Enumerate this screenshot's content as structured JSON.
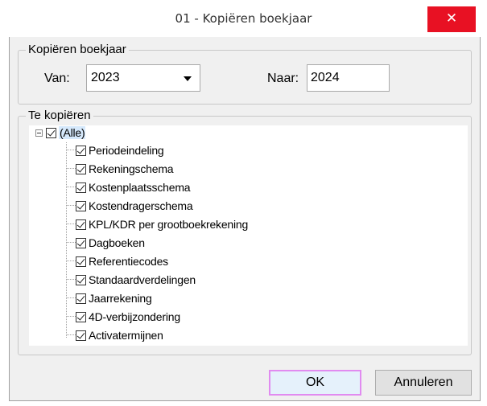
{
  "window": {
    "title": "01 - Kopiëren boekjaar",
    "close_label": "✕"
  },
  "group_year": {
    "legend": "Kopiëren boekjaar",
    "from_label": "Van:",
    "from_value": "2023",
    "to_label": "Naar:",
    "to_value": "2024"
  },
  "group_copy": {
    "legend": "Te kopiëren",
    "root": {
      "label": "(Alle)",
      "checked": true
    },
    "items": [
      {
        "label": "Periodeindeling",
        "checked": true
      },
      {
        "label": "Rekeningschema",
        "checked": true
      },
      {
        "label": "Kostenplaatsschema",
        "checked": true
      },
      {
        "label": "Kostendragerschema",
        "checked": true
      },
      {
        "label": "KPL/KDR per grootboekrekening",
        "checked": true
      },
      {
        "label": "Dagboeken",
        "checked": true
      },
      {
        "label": "Referentiecodes",
        "checked": true
      },
      {
        "label": "Standaardverdelingen",
        "checked": true
      },
      {
        "label": "Jaarrekening",
        "checked": true
      },
      {
        "label": "4D-verbijzondering",
        "checked": true
      },
      {
        "label": "Activatermijnen",
        "checked": true
      }
    ]
  },
  "buttons": {
    "ok": "OK",
    "cancel": "Annuleren"
  },
  "colors": {
    "close_bg": "#e81123",
    "dialog_bg": "#f0f0f0",
    "selection": "#d5e8fb",
    "default_button_border": "#e18bf0"
  }
}
